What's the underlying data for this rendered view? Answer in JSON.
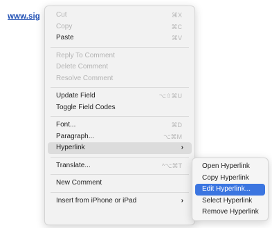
{
  "document": {
    "link_text": "www.sig"
  },
  "context_menu": {
    "items": [
      {
        "label": "Cut",
        "shortcut": "⌘X",
        "disabled": true
      },
      {
        "label": "Copy",
        "shortcut": "⌘C",
        "disabled": true
      },
      {
        "label": "Paste",
        "shortcut": "⌘V",
        "disabled": false
      },
      {
        "label": "Reply To Comment",
        "disabled": true
      },
      {
        "label": "Delete Comment",
        "disabled": true
      },
      {
        "label": "Resolve Comment",
        "disabled": true
      },
      {
        "label": "Update Field",
        "shortcut": "⌥⇧⌘U",
        "disabled": false
      },
      {
        "label": "Toggle Field Codes",
        "disabled": false
      },
      {
        "label": "Font...",
        "shortcut": "⌘D",
        "disabled": false
      },
      {
        "label": "Paragraph...",
        "shortcut": "⌥⌘M",
        "disabled": false
      },
      {
        "label": "Hyperlink",
        "submenu_indicator": "›",
        "disabled": false
      },
      {
        "label": "Translate...",
        "shortcut": "^⌥⌘T",
        "disabled": false
      },
      {
        "label": "New Comment",
        "disabled": false
      },
      {
        "label": "Insert from iPhone or iPad",
        "submenu_indicator": "›",
        "disabled": false
      }
    ]
  },
  "hyperlink_submenu": {
    "items": [
      {
        "label": "Open Hyperlink"
      },
      {
        "label": "Copy Hyperlink"
      },
      {
        "label": "Edit Hyperlink..."
      },
      {
        "label": "Select Hyperlink"
      },
      {
        "label": "Remove Hyperlink"
      }
    ],
    "selected_index": 2
  },
  "colors": {
    "selection": "#3b75e0",
    "link": "#1f4fb3"
  }
}
